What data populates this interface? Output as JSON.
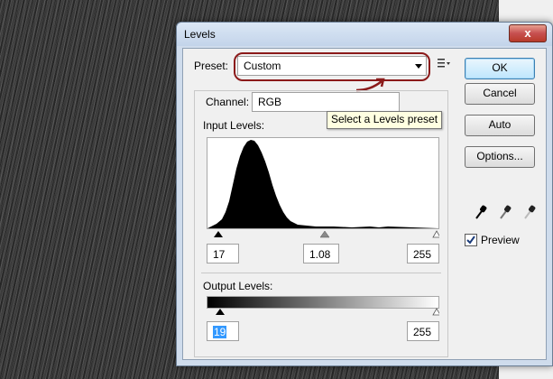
{
  "dialog": {
    "title": "Levels",
    "close_glyph": "x"
  },
  "preset": {
    "label": "Preset:",
    "value": "Custom",
    "tooltip": "Select a Levels preset",
    "menu_icon": "list-options-icon"
  },
  "channel": {
    "label": "Channel:",
    "value": "RGB"
  },
  "input_levels": {
    "label": "Input Levels:",
    "black": "17",
    "gamma": "1.08",
    "white": "255"
  },
  "output_levels": {
    "label": "Output Levels:",
    "black": "19",
    "white": "255"
  },
  "buttons": {
    "ok": "OK",
    "cancel": "Cancel",
    "auto": "Auto",
    "options": "Options..."
  },
  "preview": {
    "label": "Preview",
    "checked": true
  },
  "icons": [
    "close-icon",
    "dropdown-arrow-icon",
    "list-options-icon",
    "black-eyedropper-icon",
    "gray-eyedropper-icon",
    "white-eyedropper-icon"
  ],
  "colors": {
    "annotation": "#8b1a1a",
    "ok_accent": "#3c7fb1",
    "selection": "#3399ff"
  }
}
